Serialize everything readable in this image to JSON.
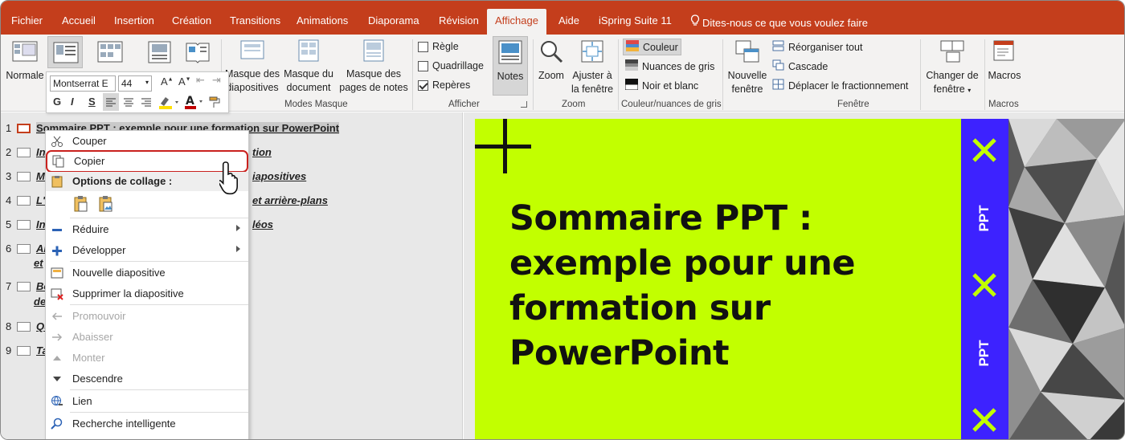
{
  "menubar": {
    "tabs": [
      "Fichier",
      "Accueil",
      "Insertion",
      "Création",
      "Transitions",
      "Animations",
      "Diaporama",
      "Révision",
      "Affichage",
      "Aide",
      "iSpring Suite 11"
    ],
    "active_tab": "Affichage",
    "tell_me": "Dites-nous ce que vous voulez faire",
    "color": "#c43e1c"
  },
  "ribbon": {
    "normale": "Normale",
    "modes_masque": {
      "label": "Modes Masque",
      "masque_diapositives_1": "Masque des",
      "masque_diapositives_2": "diapositives",
      "masque_document_1": "Masque du",
      "masque_document_2": "document",
      "masque_notes_1": "Masque des",
      "masque_notes_2": "pages de notes"
    },
    "afficher": {
      "label": "Afficher",
      "regle": "Règle",
      "quadrillage": "Quadrillage",
      "reperes": "Repères",
      "notes": "Notes"
    },
    "zoom": {
      "label": "Zoom",
      "zoom": "Zoom",
      "ajuster_1": "Ajuster à",
      "ajuster_2": "la fenêtre"
    },
    "couleur": {
      "label": "Couleur/nuances de gris",
      "couleur": "Couleur",
      "nuances": "Nuances de gris",
      "noir_blanc": "Noir et blanc"
    },
    "fenetre": {
      "label": "Fenêtre",
      "nouvelle_1": "Nouvelle",
      "nouvelle_2": "fenêtre",
      "reorganiser": "Réorganiser tout",
      "cascade": "Cascade",
      "deplacer": "Déplacer le fractionnement",
      "changer_1": "Changer de",
      "changer_2": "fenêtre"
    },
    "macros": {
      "label": "Macros",
      "macros": "Macros"
    }
  },
  "mini_toolbar": {
    "font": "Montserrat E",
    "size": "44",
    "bold": "G",
    "italic": "I",
    "underline": "S"
  },
  "outline": {
    "rows": [
      {
        "num": "1",
        "text": "Sommaire PPT : exemple pour une formation sur PowerPoint"
      },
      {
        "num": "2",
        "text": "tion"
      },
      {
        "num": "3",
        "text": "iapositives"
      },
      {
        "num": "4",
        "text": "et arrière-plans"
      },
      {
        "num": "5",
        "text": "léos"
      },
      {
        "num": "6",
        "text": ""
      },
      {
        "num": "7",
        "text": ""
      },
      {
        "num": "8",
        "text": ""
      },
      {
        "num": "9",
        "text": ""
      }
    ],
    "row6_frag_a": "Ar",
    "row6_frag_b": "et",
    "row7_frag_a": "Bo",
    "row7_frag_b": "de",
    "row2_frag": "In",
    "row3_frag": "Mo",
    "row4_frag": "L'o",
    "row5_frag": "Ins",
    "row8_frag": "Qu",
    "row9_frag": "Ta"
  },
  "context_menu": {
    "couper": "Couper",
    "copier": "Copier",
    "options_collage": "Options de collage :",
    "reduire": "Réduire",
    "developper": "Développer",
    "nouvelle": "Nouvelle diapositive",
    "supprimer": "Supprimer la diapositive",
    "promouvoir": "Promouvoir",
    "abaisser": "Abaisser",
    "monter": "Monter",
    "descendre": "Descendre",
    "lien": "Lien",
    "recherche": "Recherche intelligente"
  },
  "slide": {
    "title_line1": "Sommaire PPT :",
    "title_line2": "exemple pour une",
    "title_line3": "formation sur",
    "title_line4": "PowerPoint",
    "band_text": "PPT",
    "background_color": "#c2ff00",
    "band_color": "#3d22ff",
    "highlight_color": "#c9211e"
  }
}
